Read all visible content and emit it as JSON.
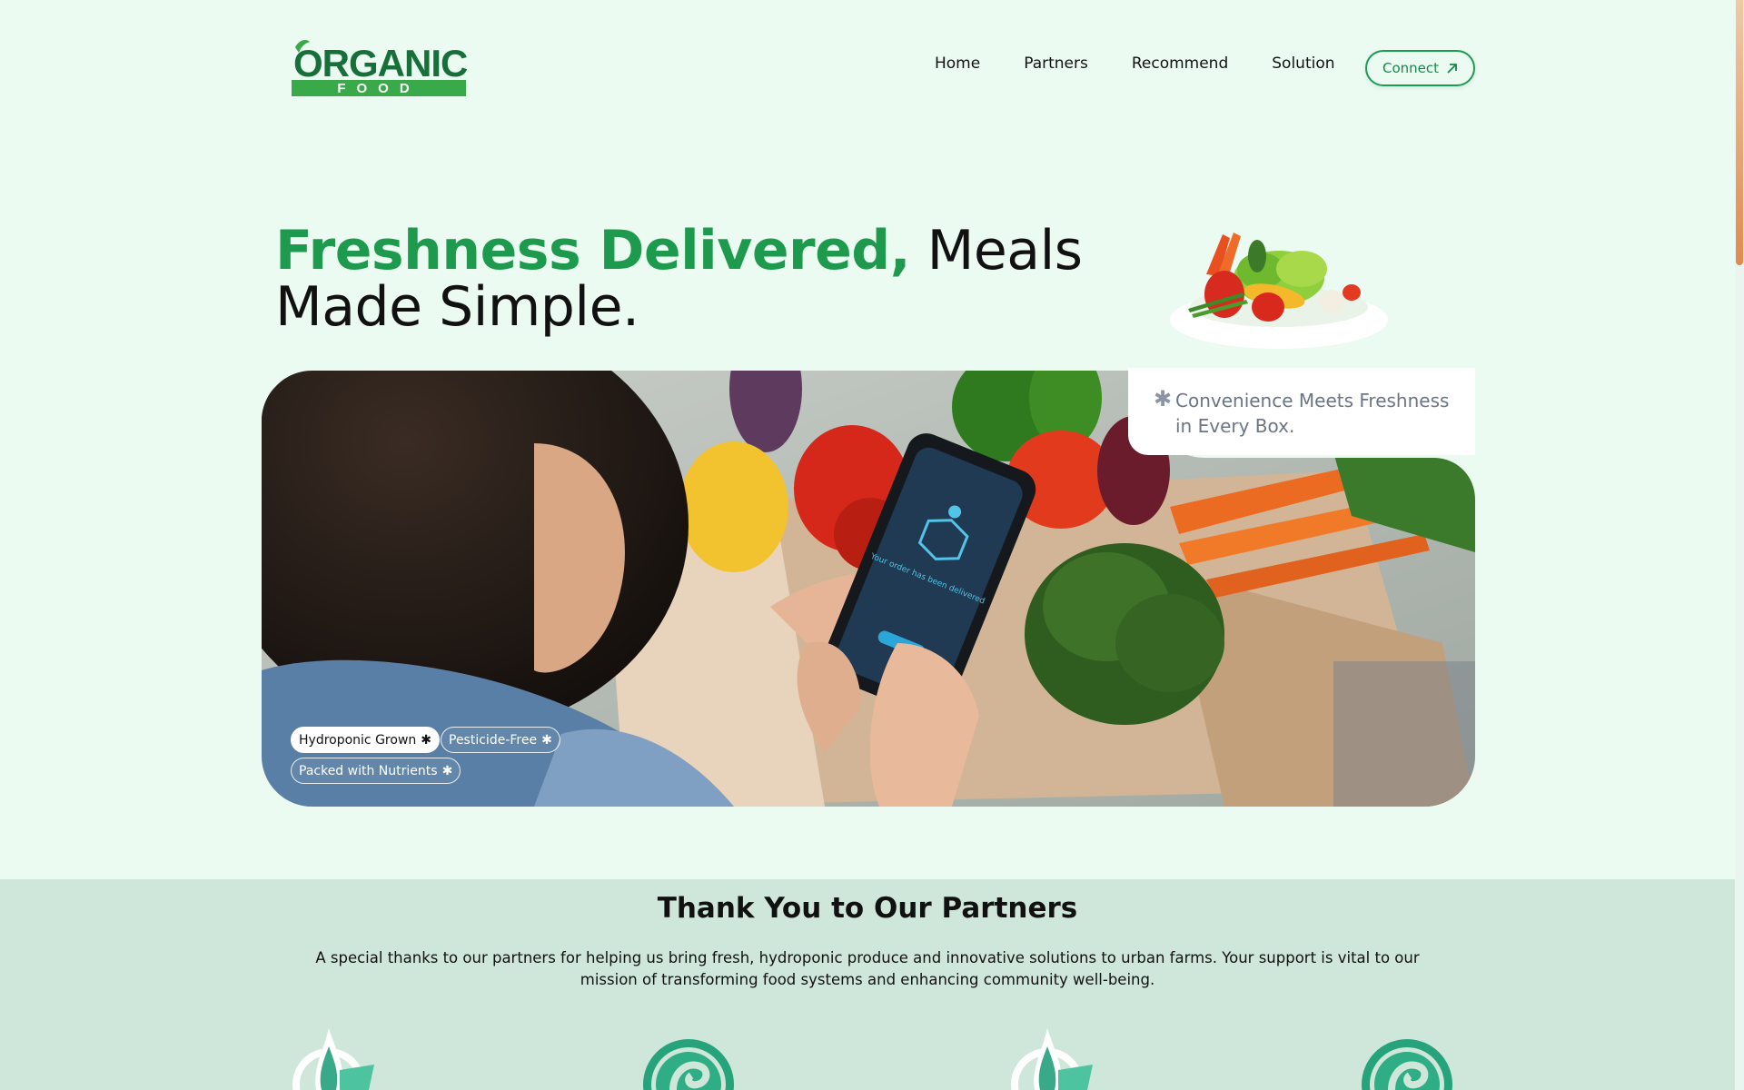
{
  "brand": {
    "logo_word": "ORGANIC",
    "logo_sub": "FOOD",
    "colors": {
      "primary": "#1d9a4e",
      "dark_green": "#17703a",
      "light_bg": "#ecfbf2",
      "section_bg": "#cfe7da"
    }
  },
  "nav": {
    "items": [
      "Home",
      "Partners",
      "Recommend",
      "Solution"
    ]
  },
  "header": {
    "connect_label": "Connect",
    "connect_icon": "arrow-up-right-icon"
  },
  "hero": {
    "title_accent": "Freshness Delivered,",
    "title_rest_1": "Meals",
    "title_rest_2": "Made Simple.",
    "quote_star": "✱",
    "quote": "Convenience Meets Freshness in Every Box.",
    "phone_text": "Your order has been delivered",
    "tags": [
      {
        "label": "Hydroponic Grown",
        "icon": "✱"
      },
      {
        "label": "Pesticide-Free",
        "icon": "✱"
      },
      {
        "label": "Packed with Nutrients",
        "icon": "✱"
      }
    ]
  },
  "partners": {
    "title": "Thank You to Our Partners",
    "description": "A special thanks to our partners for helping us bring fresh, hydroponic produce and innovative solutions to urban farms. Your support is vital to our mission of transforming food systems and enhancing community well-being.",
    "logos": [
      "leaf-drop-logo",
      "spiral-logo",
      "leaf-drop-logo",
      "spiral-logo"
    ]
  }
}
